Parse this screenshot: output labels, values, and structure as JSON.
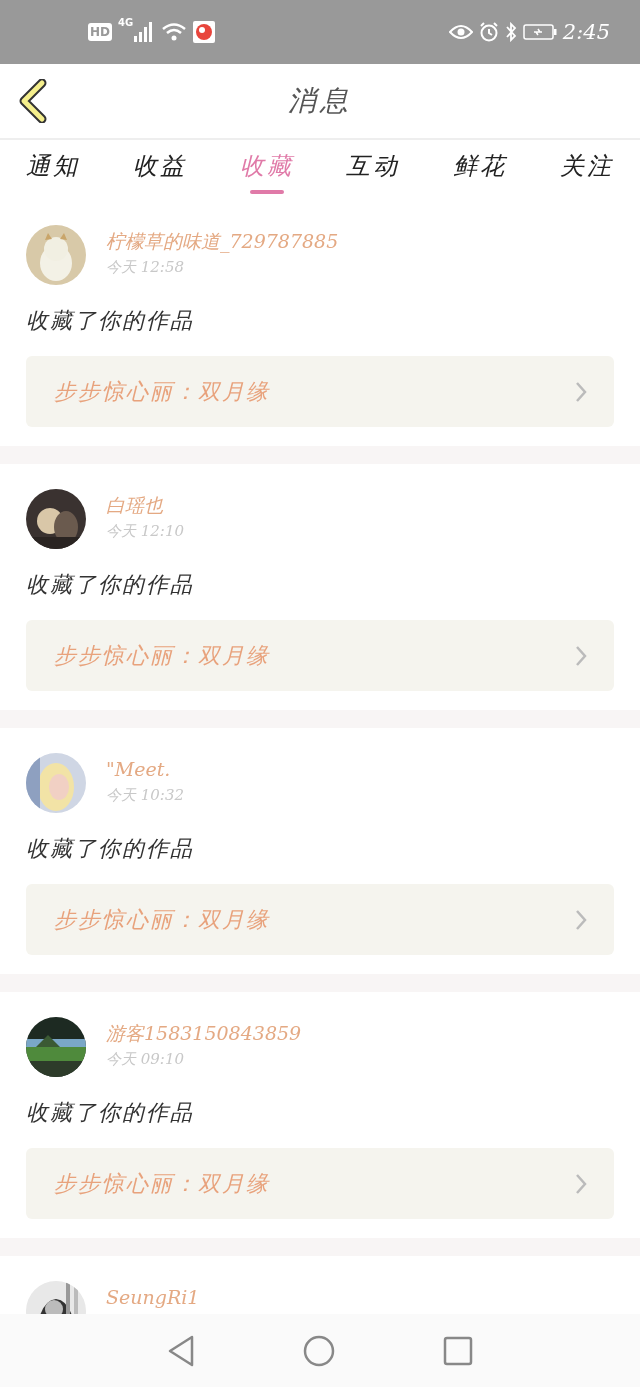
{
  "status_bar": {
    "hd": "HD",
    "network": "4G",
    "time": "2:45"
  },
  "header": {
    "title": "消息"
  },
  "tabs": [
    {
      "label": "通知",
      "selected": false
    },
    {
      "label": "收益",
      "selected": false
    },
    {
      "label": "收藏",
      "selected": true
    },
    {
      "label": "互动",
      "selected": false
    },
    {
      "label": "鲜花",
      "selected": false
    },
    {
      "label": "关注",
      "selected": false
    }
  ],
  "messages": [
    {
      "name": "柠檬草的味道_729787885",
      "time": "今天 12:58",
      "action": "收藏了你的作品",
      "work": "步步惊心丽：双月缘"
    },
    {
      "name": "白瑶也",
      "time": "今天 12:10",
      "action": "收藏了你的作品",
      "work": "步步惊心丽：双月缘"
    },
    {
      "name": "\"Meet.",
      "time": "今天 10:32",
      "action": "收藏了你的作品",
      "work": "步步惊心丽：双月缘"
    },
    {
      "name": "游客1583150843859",
      "time": "今天 09:10",
      "action": "收藏了你的作品",
      "work": "步步惊心丽：双月缘"
    },
    {
      "name": "SeungRi1"
    }
  ]
}
